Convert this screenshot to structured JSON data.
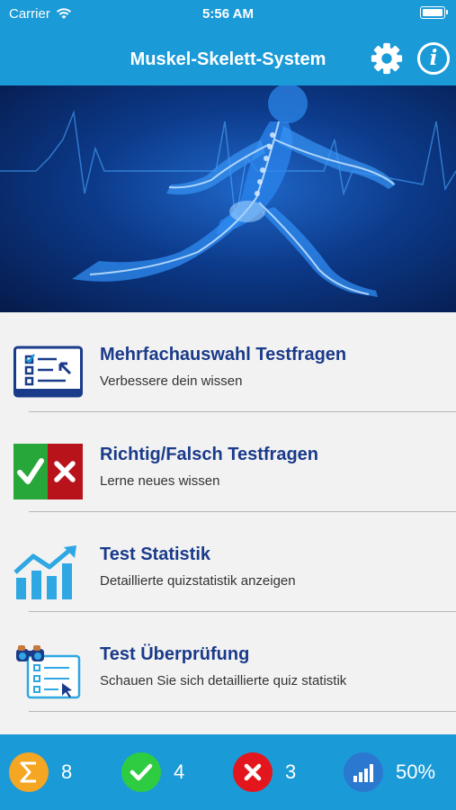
{
  "status_bar": {
    "carrier": "Carrier",
    "time": "5:56 AM"
  },
  "header": {
    "title": "Muskel-Skelett-System"
  },
  "menu": [
    {
      "title": "Mehrfachauswahl Testfragen",
      "subtitle": "Verbessere dein wissen",
      "icon": "checklist-icon"
    },
    {
      "title": "Richtig/Falsch Testfragen",
      "subtitle": "Lerne neues wissen",
      "icon": "true-false-icon"
    },
    {
      "title": "Test Statistik",
      "subtitle": "Detaillierte quizstatistik anzeigen",
      "icon": "bar-chart-icon"
    },
    {
      "title": "Test Überprüfung",
      "subtitle": "Schauen Sie sich detaillierte quiz statistik",
      "icon": "review-icon"
    }
  ],
  "footer": {
    "total": "8",
    "correct": "4",
    "wrong": "3",
    "score": "50%"
  },
  "colors": {
    "primary": "#1b9ad8",
    "heading": "#1a3a8a",
    "total": "#f5a623",
    "correct": "#2ecc40",
    "wrong": "#e3161d",
    "score": "#2a78d0"
  }
}
